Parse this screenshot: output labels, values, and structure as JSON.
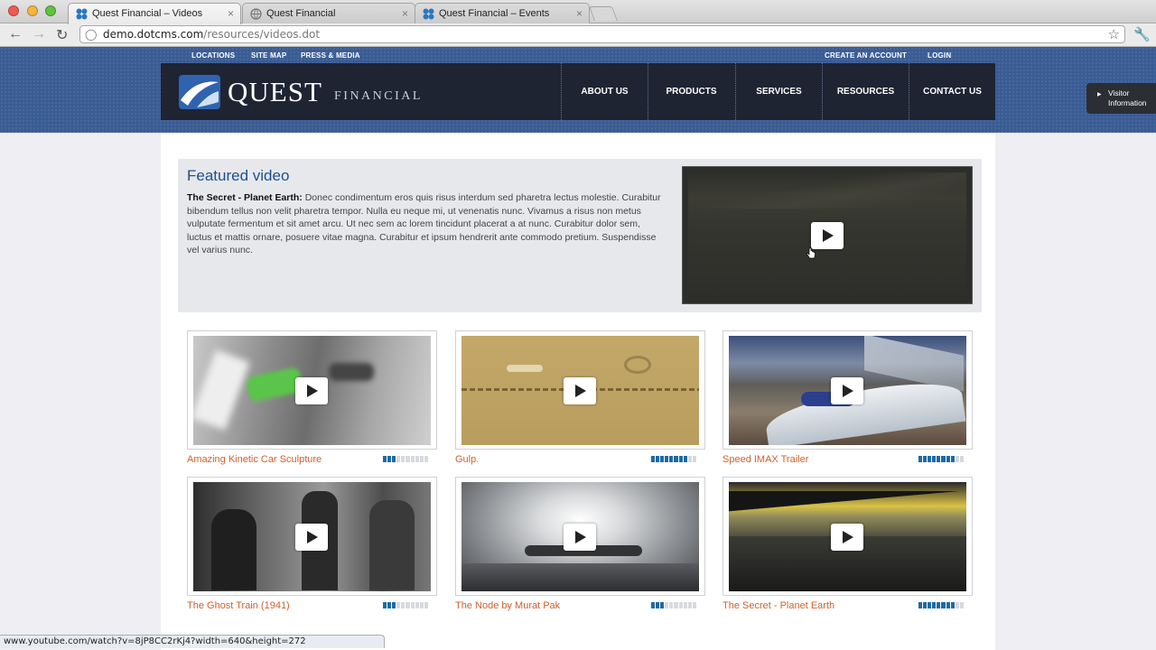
{
  "browser": {
    "tabs": [
      {
        "label": "Quest Financial – Videos",
        "active": true
      },
      {
        "label": "Quest Financial",
        "active": false
      },
      {
        "label": "Quest Financial – Events",
        "active": false
      }
    ],
    "url_host": "demo.dotcms.com",
    "url_path": "/resources/videos.dot",
    "status_url": "www.youtube.com/watch?v=8jP8CC2rKj4?width=640&height=272"
  },
  "site": {
    "util_left": [
      "LOCATIONS",
      "SITE MAP",
      "PRESS & MEDIA"
    ],
    "util_right": [
      "CREATE AN ACCOUNT",
      "LOGIN"
    ],
    "logo_main": "QUEST",
    "logo_sub": "FINANCIAL",
    "nav": [
      "ABOUT US",
      "PRODUCTS",
      "SERVICES",
      "RESOURCES",
      "CONTACT US"
    ],
    "visitor_label": "Visitor Information",
    "header_color": "#3a5c94",
    "nav_color": "#1f2433"
  },
  "featured": {
    "heading": "Featured video",
    "title": "The Secret - Planet Earth:",
    "body": " Donec condimentum eros quis risus interdum sed pharetra lectus molestie. Curabitur bibendum tellus non velit pharetra tempor. Nulla eu neque mi, ut venenatis nunc. Vivamus a risus non metus vulputate fermentum et sit amet arcu. Ut nec sem ac lorem tincidunt placerat a at nunc. Curabitur dolor sem, luctus et mattis ornare, posuere vitae magna. Curabitur et ipsum hendrerit ante commodo pretium. Suspendisse vel varius nunc."
  },
  "videos": [
    {
      "title": "Amazing Kinetic Car Sculpture",
      "rating": 3,
      "rating_max": 10
    },
    {
      "title": "Gulp.",
      "rating": 8,
      "rating_max": 10
    },
    {
      "title": "Speed IMAX Trailer",
      "rating": 8,
      "rating_max": 10
    },
    {
      "title": "The Ghost Train (1941)",
      "rating": 3,
      "rating_max": 10
    },
    {
      "title": "The Node by Murat Pak",
      "rating": 3,
      "rating_max": 10
    },
    {
      "title": "The Secret - Planet Earth",
      "rating": 8,
      "rating_max": 10
    }
  ],
  "icons": {
    "back": "back-arrow-icon",
    "forward": "forward-arrow-icon",
    "reload": "reload-icon",
    "star": "bookmark-star-icon",
    "wrench": "wrench-icon",
    "play": "play-icon"
  },
  "accent_color": "#d1602b",
  "link_blue": "#1f4f8d"
}
